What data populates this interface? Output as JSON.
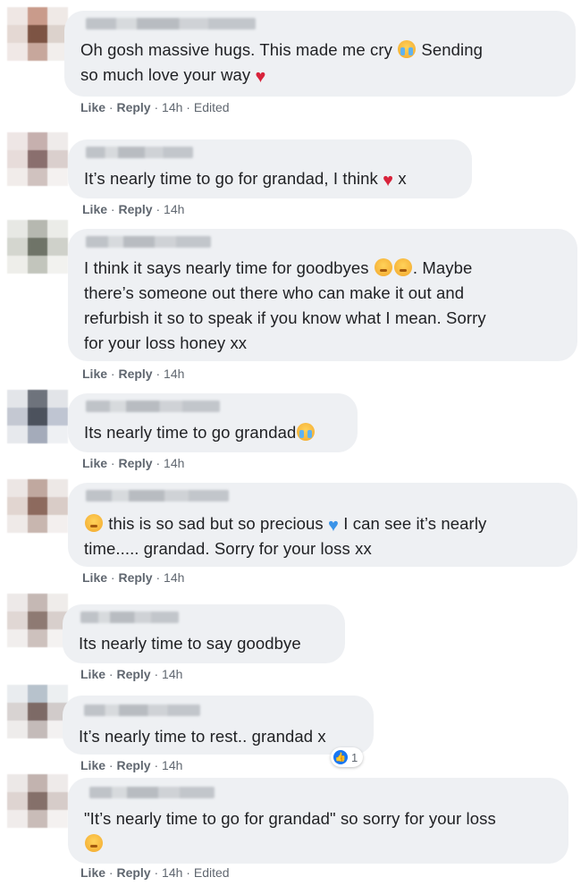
{
  "actions": {
    "like": "Like",
    "reply": "Reply",
    "dot": "·",
    "edited": "Edited"
  },
  "reaction": {
    "count": "1"
  },
  "comments": [
    {
      "line1": "Oh gosh massive hugs. This made me cry ",
      "line1b": " Sending",
      "line2": "so much love your way ",
      "time": "14h"
    },
    {
      "line1": "It’s nearly time to go for grandad, I think ",
      "line1b": " x",
      "time": "14h"
    },
    {
      "line1": "I think it says nearly time for goodbyes ",
      "line1b": ". Maybe",
      "line2": "there’s someone out there who can make it out and",
      "line3": "refurbish it so to speak if you know what I mean. Sorry",
      "line4": "for your loss honey xx",
      "time": "14h"
    },
    {
      "line1": "Its nearly time to go grandad",
      "time": "14h"
    },
    {
      "line1": " this is so sad but so precious ",
      "line1b": " I can see it’s nearly",
      "line2": "time..... grandad. Sorry for your loss xx",
      "time": "14h"
    },
    {
      "line1": "Its nearly time to say goodbye",
      "time": "14h"
    },
    {
      "line1": "It’s nearly time to rest.. grandad x",
      "time": "14h"
    },
    {
      "line1": "\"It’s nearly time to go for grandad\" so sorry for your loss",
      "time": "14h"
    }
  ]
}
